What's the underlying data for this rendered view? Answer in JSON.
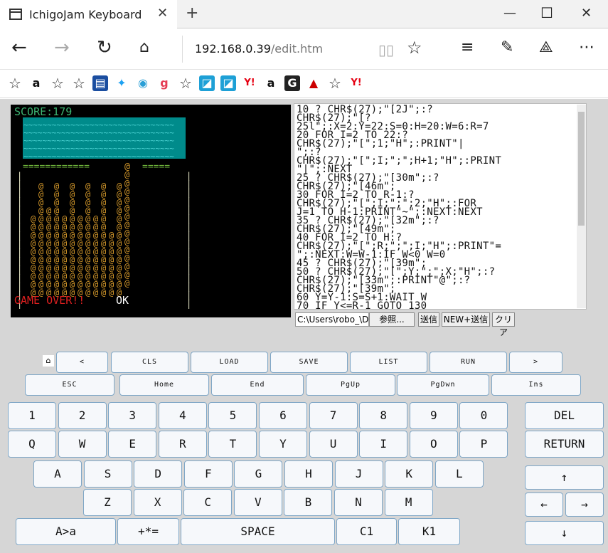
{
  "browser": {
    "tab_title": "IchigoJam Keyboard",
    "url_host": "192.168.0.39",
    "url_path": "/edit.htm"
  },
  "favorites": [
    {
      "icon": "star-icon",
      "glyph": "☆",
      "color": "#333",
      "bg": "#fff"
    },
    {
      "icon": "amazon-icon",
      "glyph": "a",
      "color": "#111",
      "bg": "#fff"
    },
    {
      "icon": "star-icon",
      "glyph": "☆",
      "color": "#333",
      "bg": "#fff"
    },
    {
      "icon": "star-icon",
      "glyph": "☆",
      "color": "#333",
      "bg": "#fff"
    },
    {
      "icon": "news-icon",
      "glyph": "▤",
      "color": "#fff",
      "bg": "#1b4ea0"
    },
    {
      "icon": "twitter-icon",
      "glyph": "✦",
      "color": "#1da1f2",
      "bg": "#fff"
    },
    {
      "icon": "circle-eye-icon",
      "glyph": "◉",
      "color": "#2a9fd6",
      "bg": "#fff"
    },
    {
      "icon": "g-red-icon",
      "glyph": "g",
      "color": "#e53c54",
      "bg": "#fff"
    },
    {
      "icon": "star-icon",
      "glyph": "☆",
      "color": "#333",
      "bg": "#fff"
    },
    {
      "icon": "square-blue-icon",
      "glyph": "◪",
      "color": "#fff",
      "bg": "#1ea0d6"
    },
    {
      "icon": "square-blue-icon",
      "glyph": "◪",
      "color": "#fff",
      "bg": "#1ea0d6"
    },
    {
      "icon": "yahoo-icon",
      "glyph": "Y!",
      "color": "#e60012",
      "bg": "#fff"
    },
    {
      "icon": "amazon-icon",
      "glyph": "a",
      "color": "#111",
      "bg": "#fff"
    },
    {
      "icon": "g-black-icon",
      "glyph": "G",
      "color": "#fff",
      "bg": "#222"
    },
    {
      "icon": "rocket-icon",
      "glyph": "▲",
      "color": "#c00",
      "bg": "#fff"
    },
    {
      "icon": "star-icon",
      "glyph": "☆",
      "color": "#333",
      "bg": "#fff"
    },
    {
      "icon": "yahoo-icon",
      "glyph": "Y!",
      "color": "#e60012",
      "bg": "#fff"
    }
  ],
  "game": {
    "score": "SCORE:179",
    "status": "GAME OVER!!",
    "ok": "OK",
    "colors": {
      "score": "#3cb371",
      "water": "#008b8b",
      "wave": "#4fd6d6",
      "ground": "#6fb33b",
      "tower": "#d79a2b",
      "wall": "#e8e8c8",
      "over": "#e02020"
    }
  },
  "editor": {
    "lines": [
      "10 ? CHR$(27);\"[2J\";:?",
      "CHR$(27);\"[?",
      "25l\";:X=2:Y=22:S=0:H=20:W=6:R=7",
      "20 FOR I=2 TO 22:?",
      "CHR$(27);\"[\";1;\"H\";:PRINT\"|",
      "\";:?",
      "CHR$(27);\"[\";I;\";\";H+1;\"H\";:PRINT",
      "\"|\";:NEXT",
      "25 ? CHR$(27);\"[30m\";:?",
      "CHR$(27);\"[46m\";",
      "30 FOR I=2 TO R-1:?",
      "CHR$(27);\"[\";I;\";\";2;\"H\";:FOR",
      "J=1 TO H-1:PRINT\"~\";:NEXT:NEXT",
      "35 ? CHR$(27);\"[32m\";:?",
      "CHR$(27);\"[49m\";",
      "40 FOR I=2 TO H:?",
      "CHR$(27);\"[\";R;\";\";I;\"H\";:PRINT\"=",
      "\";:NEXT:W=W-1:IF W<0 W=0",
      "45 ? CHR$(27);\"[39m\";",
      "50 ? CHR$(27);\"[\";Y;\";\";X;\"H\";:?",
      "CHR$(27);\"[33m\";:PRINT\"@\";:?",
      "CHR$(27);\"[39m\";",
      "60 Y=Y-1:S=S+1:WAIT W",
      "70 IF Y<=R-1 GOTO 130"
    ],
    "file_path": "C:\\Users\\robo_\\D",
    "browse_label": "参照...",
    "send_label": "送信",
    "new_send_label": "NEW+送信",
    "clear_label": "クリア"
  },
  "keyboard": {
    "home_glyph": "⌂",
    "row_fn1": [
      "<",
      "CLS",
      "LOAD",
      "SAVE",
      "LIST",
      "RUN",
      ">"
    ],
    "row_fn2": [
      "ESC",
      "Home",
      "End",
      "PgUp",
      "PgDwn",
      "Ins"
    ],
    "row_num": [
      "1",
      "2",
      "3",
      "4",
      "5",
      "6",
      "7",
      "8",
      "9",
      "0"
    ],
    "row_q": [
      "Q",
      "W",
      "E",
      "R",
      "T",
      "Y",
      "U",
      "I",
      "O",
      "P"
    ],
    "row_a": [
      "A",
      "S",
      "D",
      "F",
      "G",
      "H",
      "J",
      "K",
      "L"
    ],
    "row_z": [
      "Z",
      "X",
      "C",
      "V",
      "B",
      "N",
      "M"
    ],
    "row_bottom": [
      "A>a",
      "+*=",
      "SPACE",
      "C1",
      "K1"
    ],
    "del": "DEL",
    "return": "RETURN",
    "up": "↑",
    "left": "←",
    "right": "→",
    "down": "↓"
  }
}
